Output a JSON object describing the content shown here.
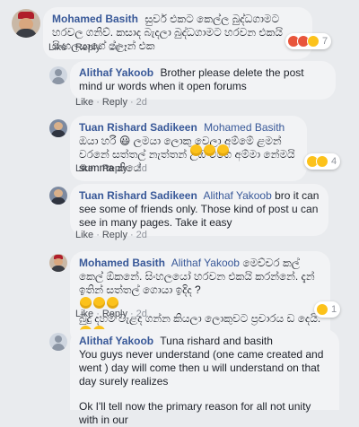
{
  "actions": {
    "like": "Like",
    "reply": "Reply",
    "sep": "·"
  },
  "comments": [
    {
      "author": "Mohamed Basith",
      "text": "සුවර් එකට කෙල්ල බුද්ධගාමට හරවල ගනිව්. කසාද බැදලා බුද්ධගාමට හරවන එකයි සිංහලයාගේ ප්ලෑන් එක",
      "time": "2d",
      "reaction_count": "7"
    },
    {
      "author": "Alithaf Yakoob",
      "text": "Brother please delete the post mind ur words when it open forums",
      "time": "2d"
    },
    {
      "author": "Tuan Rishard Sadikeen",
      "mention": "Mohamed Basith",
      "text": "ඔයා හරි 😃 ලමයා ලොකු වෙලා අම්මේ ළමන් වරනේ සත්තල් නැත්තන් උඹ මගෙ අම්මා නේමයි summa කියේ",
      "time": "2d",
      "reaction_count": "4"
    },
    {
      "author": "Tuan Rishard Sadikeen",
      "mention": "Alithaf Yakoob",
      "text": "bro it can see some of friends only. Those kind of post u can see in many pages. Take it easy",
      "time": "2d"
    },
    {
      "author": "Mohamed Basith",
      "mention": "Alithaf Yakoob",
      "text": "මෙච්චර කල් කෙල් ඕකනේ. සිංහලයෝ හරවන එකයි කරන්නේ. දැන් ඉතින් සත්තල් ගොයා ඉදිද ?",
      "text2": "බුදු දහම් වැළද ගන්න කියලා ලොකුවට ප්‍රචාරය ඩ දෙයි.",
      "time": "2d",
      "reaction_count": "1"
    },
    {
      "author": "Alithaf Yakoob",
      "text": "Tuna rishard and basith",
      "text_line2": "You guys never understand (one came created and went ) day will come then u will understand on that day surely realizes",
      "text_line3": "Ok I'll tell now the primary reason for all not unity with in our"
    }
  ]
}
